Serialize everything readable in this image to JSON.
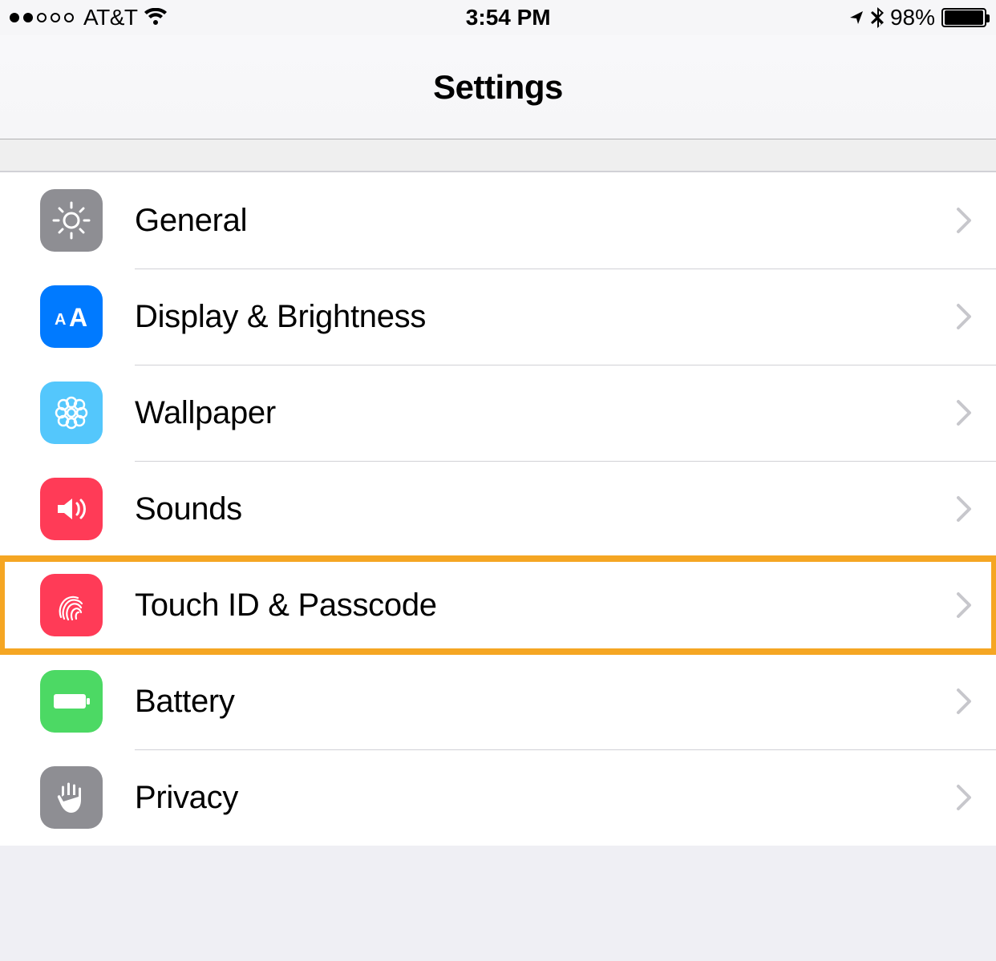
{
  "status": {
    "carrier": "AT&T",
    "time": "3:54 PM",
    "battery_pct": "98%"
  },
  "nav": {
    "title": "Settings"
  },
  "rows": [
    {
      "label": "General"
    },
    {
      "label": "Display & Brightness"
    },
    {
      "label": "Wallpaper"
    },
    {
      "label": "Sounds"
    },
    {
      "label": "Touch ID & Passcode"
    },
    {
      "label": "Battery"
    },
    {
      "label": "Privacy"
    }
  ],
  "highlight_index": 4
}
